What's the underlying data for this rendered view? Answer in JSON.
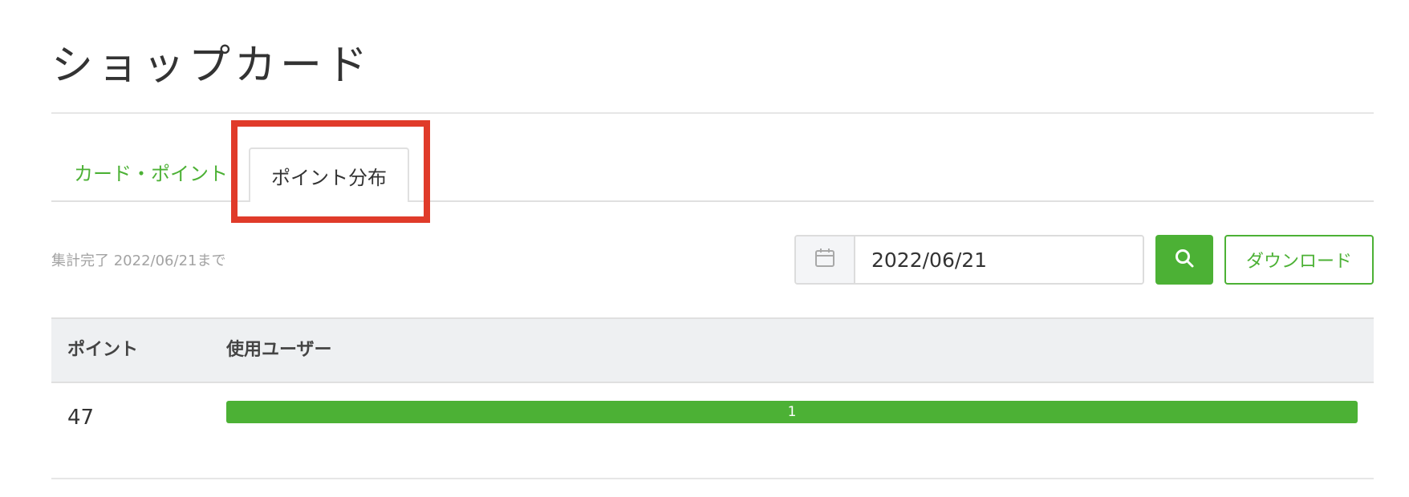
{
  "page": {
    "title": "ショップカード"
  },
  "tabs": [
    {
      "label": "カード・ポイント",
      "active": false
    },
    {
      "label": "ポイント分布",
      "active": true
    }
  ],
  "toolbar": {
    "aggregation_note": "集計完了 2022/06/21まで",
    "calendar_icon": "calendar-icon",
    "date_value": "2022/06/21",
    "search_icon": "search-icon",
    "download_label": "ダウンロード"
  },
  "table": {
    "headers": {
      "points": "ポイント",
      "users": "使用ユーザー"
    },
    "rows": [
      {
        "points": "47",
        "users": "1",
        "bar_fraction": 1.0
      }
    ]
  },
  "colors": {
    "accent": "#4cb135",
    "highlight": "#e03b2a"
  }
}
